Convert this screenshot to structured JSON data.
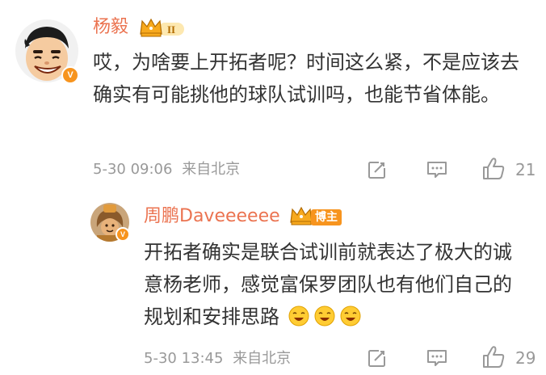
{
  "comment": {
    "user": "杨毅",
    "level": "II",
    "text": "哎，为啥要上开拓者呢？时间这么紧，不是应该去确实有可能挑他的球队试训吗，也能节省体能。",
    "date": "5-30 09:06",
    "location": "来自北京",
    "likes": "21"
  },
  "reply": {
    "user": "周鹏Daveeeeee",
    "badge": "博主",
    "text": "开拓者确实是联合试训前就表达了极大的诚意杨老师，感觉富保罗团队也有他们自己的规划和安排思路",
    "emoji_count": 3,
    "date": "5-30 13:45",
    "location": "来自北京",
    "likes": "29"
  },
  "colors": {
    "name": "#eb7350",
    "text": "#333333",
    "meta": "#999999",
    "vip_gold": "#f7a91e",
    "badge_orange": "#f7941e"
  },
  "icons": [
    "verified-v-icon",
    "crown-level-icon",
    "repost-icon",
    "comment-icon",
    "like-icon",
    "laugh-emoji-icon"
  ]
}
